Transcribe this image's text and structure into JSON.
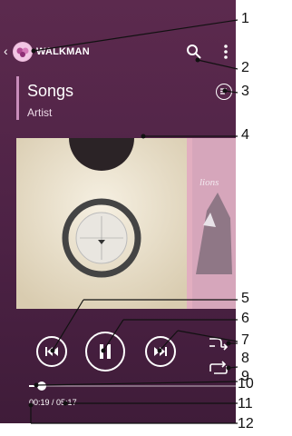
{
  "app": {
    "title": "WALKMAN",
    "back_glyph": "‹"
  },
  "track": {
    "title": "Songs",
    "artist": "Artist"
  },
  "playback": {
    "elapsed": "00:19",
    "total": "05:17",
    "separator": " / ",
    "progress_fraction": 0.06
  },
  "callouts": [
    "1",
    "2",
    "3",
    "4",
    "5",
    "6",
    "7",
    "8",
    "9",
    "10",
    "11",
    "12"
  ],
  "colors": {
    "background": "#4d2245",
    "accent": "#c98dbb"
  }
}
